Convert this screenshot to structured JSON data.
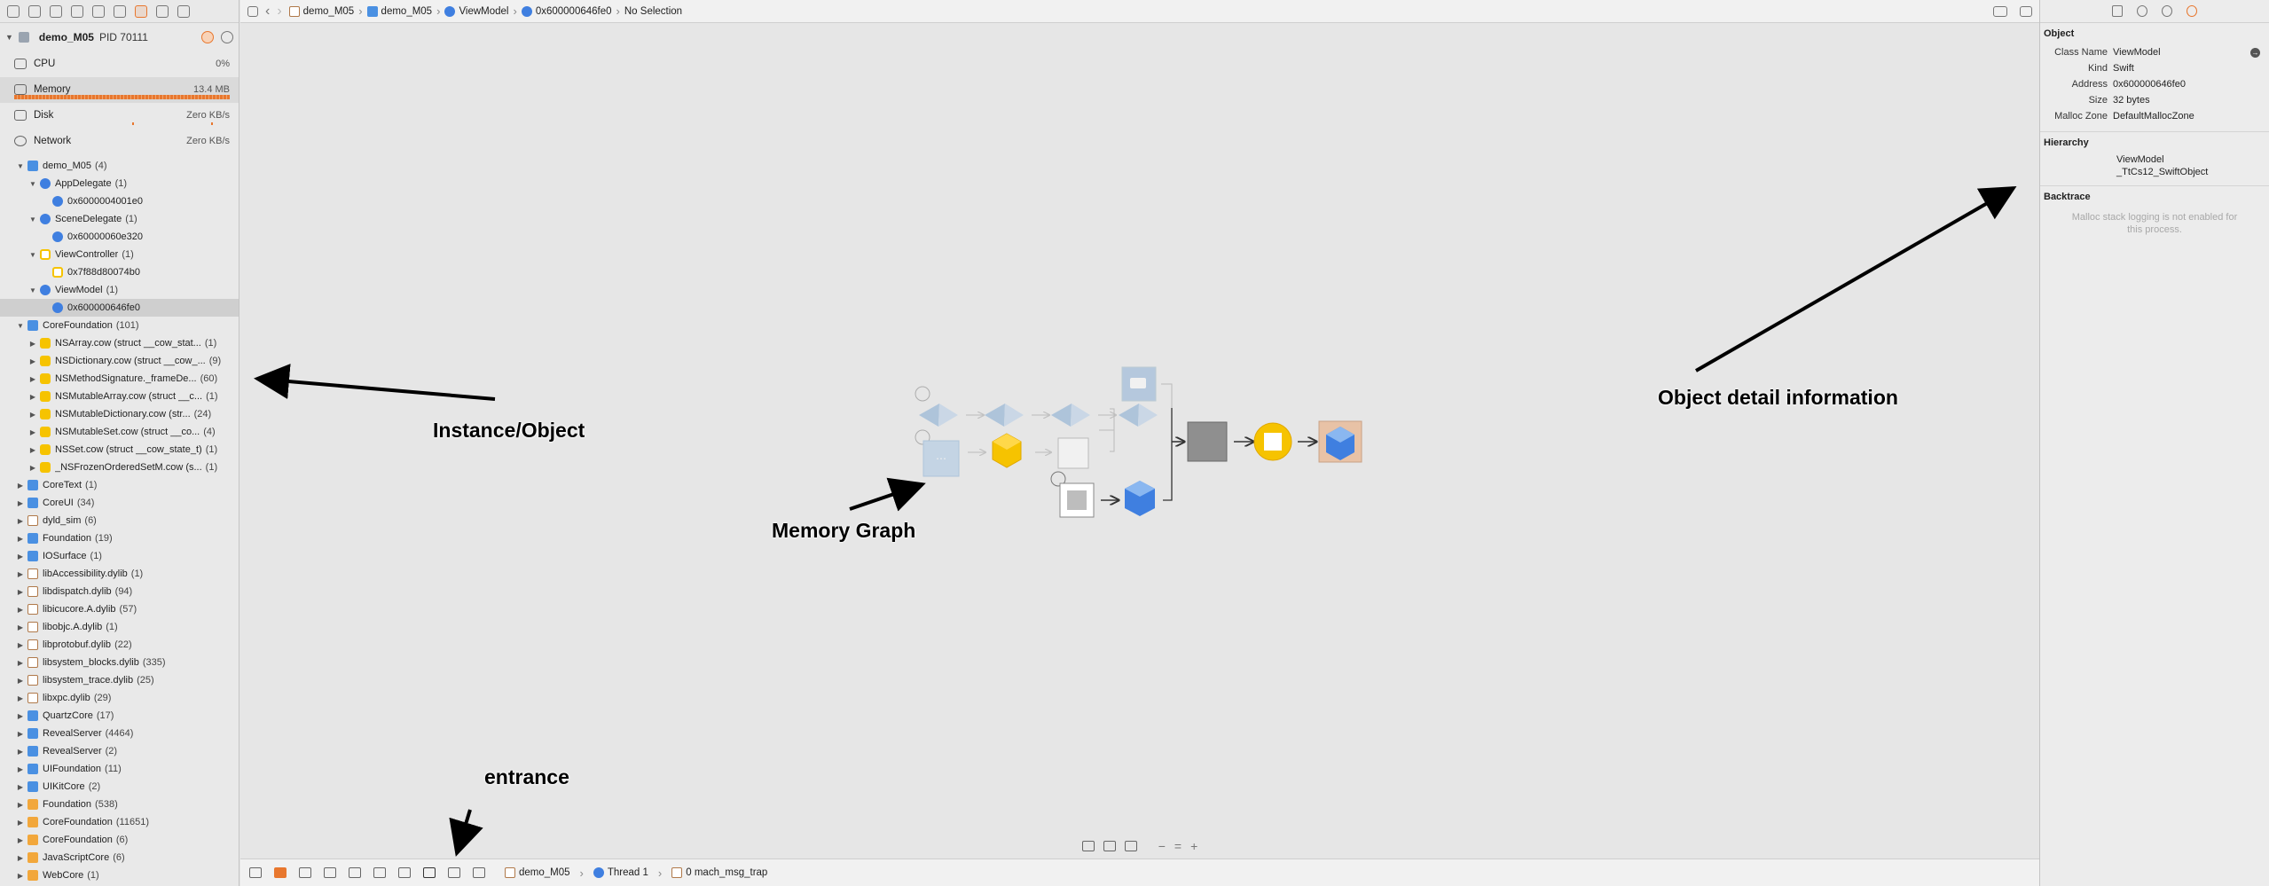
{
  "process": {
    "name": "demo_M05",
    "pid": "PID 70111"
  },
  "gauges": [
    {
      "label": "CPU",
      "value": "0%"
    },
    {
      "label": "Memory",
      "value": "13.4 MB"
    },
    {
      "label": "Disk",
      "value": "Zero KB/s"
    },
    {
      "label": "Network",
      "value": "Zero KB/s"
    }
  ],
  "tree": [
    {
      "depth": 0,
      "open": true,
      "icon": "app",
      "name": "demo_M05",
      "count": "(4)"
    },
    {
      "depth": 1,
      "open": true,
      "icon": "blue",
      "name": "AppDelegate",
      "count": "(1)"
    },
    {
      "depth": 2,
      "open": null,
      "icon": "blue",
      "name": "0x6000004001e0",
      "count": ""
    },
    {
      "depth": 1,
      "open": true,
      "icon": "blue",
      "name": "SceneDelegate",
      "count": "(1)"
    },
    {
      "depth": 2,
      "open": null,
      "icon": "blue",
      "name": "0x60000060e320",
      "count": ""
    },
    {
      "depth": 1,
      "open": true,
      "icon": "yellow-o",
      "name": "ViewController",
      "count": "(1)"
    },
    {
      "depth": 2,
      "open": null,
      "icon": "yellow-o",
      "name": "0x7f88d80074b0",
      "count": ""
    },
    {
      "depth": 1,
      "open": true,
      "icon": "blue",
      "name": "ViewModel",
      "count": "(1)"
    },
    {
      "depth": 2,
      "open": null,
      "icon": "blue",
      "name": "0x600000646fe0",
      "count": "",
      "selected": true
    },
    {
      "depth": 0,
      "open": true,
      "icon": "app",
      "name": "CoreFoundation",
      "count": "(101)"
    },
    {
      "depth": 1,
      "open": false,
      "icon": "yellow",
      "name": "NSArray.cow (struct __cow_stat...",
      "count": "(1)"
    },
    {
      "depth": 1,
      "open": false,
      "icon": "yellow",
      "name": "NSDictionary.cow (struct __cow_...",
      "count": "(9)"
    },
    {
      "depth": 1,
      "open": false,
      "icon": "yellow",
      "name": "NSMethodSignature._frameDe...",
      "count": "(60)"
    },
    {
      "depth": 1,
      "open": false,
      "icon": "yellow",
      "name": "NSMutableArray.cow (struct __c...",
      "count": "(1)"
    },
    {
      "depth": 1,
      "open": false,
      "icon": "yellow",
      "name": "NSMutableDictionary.cow (str...",
      "count": "(24)"
    },
    {
      "depth": 1,
      "open": false,
      "icon": "yellow",
      "name": "NSMutableSet.cow (struct __co...",
      "count": "(4)"
    },
    {
      "depth": 1,
      "open": false,
      "icon": "yellow",
      "name": "NSSet.cow (struct __cow_state_t)",
      "count": "(1)"
    },
    {
      "depth": 1,
      "open": false,
      "icon": "yellow",
      "name": "_NSFrozenOrderedSetM.cow (s...",
      "count": "(1)"
    },
    {
      "depth": 0,
      "open": false,
      "icon": "app",
      "name": "CoreText",
      "count": "(1)"
    },
    {
      "depth": 0,
      "open": false,
      "icon": "app",
      "name": "CoreUI",
      "count": "(34)"
    },
    {
      "depth": 0,
      "open": false,
      "icon": "dylib",
      "name": "dyld_sim",
      "count": "(6)"
    },
    {
      "depth": 0,
      "open": false,
      "icon": "app",
      "name": "Foundation",
      "count": "(19)"
    },
    {
      "depth": 0,
      "open": false,
      "icon": "app",
      "name": "IOSurface",
      "count": "(1)"
    },
    {
      "depth": 0,
      "open": false,
      "icon": "dylib",
      "name": "libAccessibility.dylib",
      "count": "(1)"
    },
    {
      "depth": 0,
      "open": false,
      "icon": "dylib",
      "name": "libdispatch.dylib",
      "count": "(94)"
    },
    {
      "depth": 0,
      "open": false,
      "icon": "dylib",
      "name": "libicucore.A.dylib",
      "count": "(57)"
    },
    {
      "depth": 0,
      "open": false,
      "icon": "dylib",
      "name": "libobjc.A.dylib",
      "count": "(1)"
    },
    {
      "depth": 0,
      "open": false,
      "icon": "dylib",
      "name": "libprotobuf.dylib",
      "count": "(22)"
    },
    {
      "depth": 0,
      "open": false,
      "icon": "dylib",
      "name": "libsystem_blocks.dylib",
      "count": "(335)"
    },
    {
      "depth": 0,
      "open": false,
      "icon": "dylib",
      "name": "libsystem_trace.dylib",
      "count": "(25)"
    },
    {
      "depth": 0,
      "open": false,
      "icon": "dylib",
      "name": "libxpc.dylib",
      "count": "(29)"
    },
    {
      "depth": 0,
      "open": false,
      "icon": "app",
      "name": "QuartzCore",
      "count": "(17)"
    },
    {
      "depth": 0,
      "open": false,
      "icon": "app",
      "name": "RevealServer",
      "count": "(4464)"
    },
    {
      "depth": 0,
      "open": false,
      "icon": "app",
      "name": "RevealServer",
      "count": "(2)"
    },
    {
      "depth": 0,
      "open": false,
      "icon": "app",
      "name": "UIFoundation",
      "count": "(11)"
    },
    {
      "depth": 0,
      "open": false,
      "icon": "app",
      "name": "UIKitCore",
      "count": "(2)"
    },
    {
      "depth": 0,
      "open": false,
      "icon": "orange",
      "name": "Foundation",
      "count": "(538)"
    },
    {
      "depth": 0,
      "open": false,
      "icon": "orange",
      "name": "CoreFoundation",
      "count": "(11651)"
    },
    {
      "depth": 0,
      "open": false,
      "icon": "orange",
      "name": "CoreFoundation",
      "count": "(6)"
    },
    {
      "depth": 0,
      "open": false,
      "icon": "orange",
      "name": "JavaScriptCore",
      "count": "(6)"
    },
    {
      "depth": 0,
      "open": false,
      "icon": "orange",
      "name": "WebCore",
      "count": "(1)"
    }
  ],
  "breadcrumb": [
    {
      "label": "demo_M05",
      "icon": "dylib"
    },
    {
      "label": "demo_M05",
      "icon": "app"
    },
    {
      "label": "ViewModel",
      "icon": "blue"
    },
    {
      "label": "0x600000646fe0",
      "icon": "blue"
    },
    {
      "label": "No Selection",
      "icon": ""
    }
  ],
  "annotations": {
    "instance": "Instance/Object",
    "graph": "Memory Graph",
    "detail": "Object detail information",
    "entrance": "entrance"
  },
  "inspector": {
    "object_title": "Object",
    "fields": [
      {
        "k": "Class Name",
        "v": "ViewModel"
      },
      {
        "k": "Kind",
        "v": "Swift"
      },
      {
        "k": "Address",
        "v": "0x600000646fe0"
      },
      {
        "k": "Size",
        "v": "32 bytes"
      },
      {
        "k": "Malloc Zone",
        "v": "DefaultMallocZone"
      }
    ],
    "hierarchy_title": "Hierarchy",
    "hierarchy": [
      "ViewModel",
      "_TtCs12_SwiftObject"
    ],
    "backtrace_title": "Backtrace",
    "backtrace_msg": "Malloc stack logging is not enabled for this process."
  },
  "debugbar": {
    "crumbs": [
      {
        "label": "demo_M05",
        "icon": "dylib"
      },
      {
        "label": "Thread 1",
        "icon": "blue"
      },
      {
        "label": "0 mach_msg_trap",
        "icon": "dylib"
      }
    ]
  },
  "colors": {
    "accent": "#e8772e",
    "swift_blue": "#3f7fe0",
    "objc_yellow": "#f6c300"
  }
}
